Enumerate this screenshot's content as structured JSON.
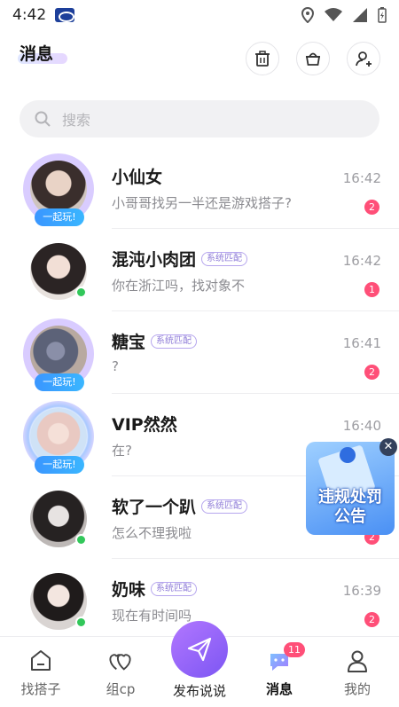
{
  "status_bar": {
    "time": "4:42"
  },
  "header": {
    "title": "消息"
  },
  "search": {
    "placeholder": "搜索"
  },
  "messages": [
    {
      "name": "小仙女",
      "time": "16:42",
      "preview": "小哥哥找另一半还是游戏搭子?",
      "unread": "2",
      "tag": "",
      "play_tag": "一起玩!"
    },
    {
      "name": "混沌小肉团",
      "time": "16:42",
      "preview": "你在浙江吗，找对象不",
      "unread": "1",
      "tag": "系统匹配",
      "play_tag": ""
    },
    {
      "name": "糖宝",
      "time": "16:41",
      "preview": "?",
      "unread": "2",
      "tag": "系统匹配",
      "play_tag": "一起玩!"
    },
    {
      "name": "VIP然然",
      "time": "16:40",
      "preview": "在?",
      "unread": "",
      "tag": "",
      "play_tag": "一起玩!"
    },
    {
      "name": "软了一个趴",
      "time": "",
      "preview": "怎么不理我啦",
      "unread": "2",
      "tag": "系统匹配",
      "play_tag": ""
    },
    {
      "name": "奶味",
      "time": "16:39",
      "preview": "现在有时间吗",
      "unread": "2",
      "tag": "系统匹配",
      "play_tag": ""
    }
  ],
  "notice": {
    "text_line1": "违规处罚",
    "text_line2": "公告",
    "close": "✕"
  },
  "bottom_nav": {
    "find": "找搭子",
    "cp": "组cp",
    "publish": "发布说说",
    "messages": "消息",
    "messages_badge": "11",
    "mine": "我的"
  },
  "colors": {
    "accent": "#8a63f5",
    "badge": "#ff4f78",
    "online": "#32c75a",
    "play_tag": "#3a9cff"
  }
}
